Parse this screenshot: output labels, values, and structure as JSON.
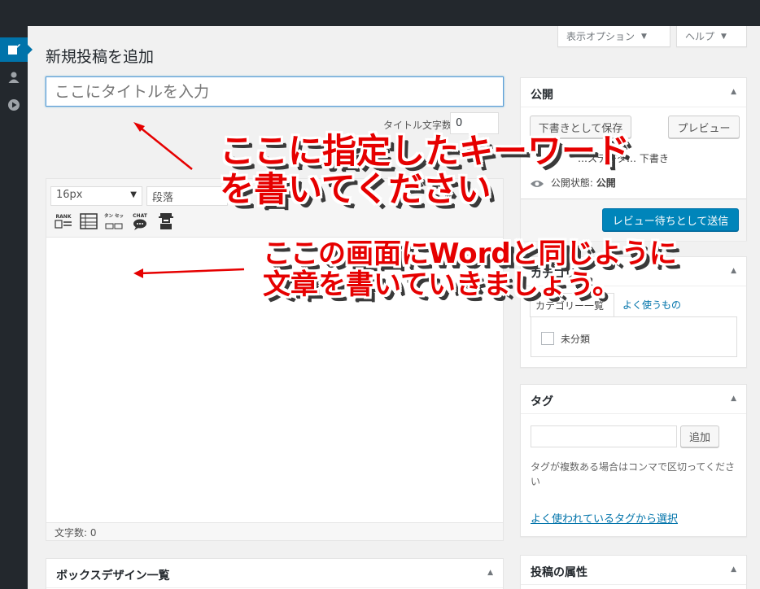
{
  "screen_options": {
    "display_options": "表示オプション",
    "help": "ヘルプ",
    "caret": "▼"
  },
  "page": {
    "title": "新規投稿を追加",
    "title_placeholder": "ここにタイトルを入力"
  },
  "title_counter": {
    "label": "タイトル文字数:",
    "value": "0"
  },
  "editor": {
    "font_size": "16px",
    "format": "段落",
    "dropdown": "▼",
    "icon_labels": {
      "rank": "RANK",
      "button": "ボタン セット",
      "chat": "CHAT"
    },
    "word_count": "文字数: 0"
  },
  "publish": {
    "title": "公開",
    "save_draft": "下書きとして保存",
    "preview": "プレビュー",
    "visibility_label": "公開状態:",
    "visibility_value": "公開",
    "submit_review": "レビュー待ちとして送信",
    "partial_status": "…ステータ… 下書き"
  },
  "category": {
    "title": "カテゴリー",
    "tab_all": "カテゴリー一覧",
    "tab_popular": "よく使うもの",
    "item": "未分類"
  },
  "tags": {
    "title": "タグ",
    "add": "追加",
    "help": "タグが複数ある場合はコンマで区切ってください",
    "choose": "よく使われているタグから選択"
  },
  "attributes": {
    "title": "投稿の属性"
  },
  "box_design": {
    "title": "ボックスデザイン一覧"
  },
  "toggle": "▲",
  "annotations": {
    "title_note_line1": "ここに指定したキーワード",
    "title_note_line2": "を書いてください",
    "body_note_line1": "ここの画面にWordと同じように",
    "body_note_line2": "文章を書いていきましょう。"
  },
  "colors": {
    "admin_dark": "#23282d",
    "accent_blue": "#0073aa",
    "annotation_red": "#e60000"
  }
}
